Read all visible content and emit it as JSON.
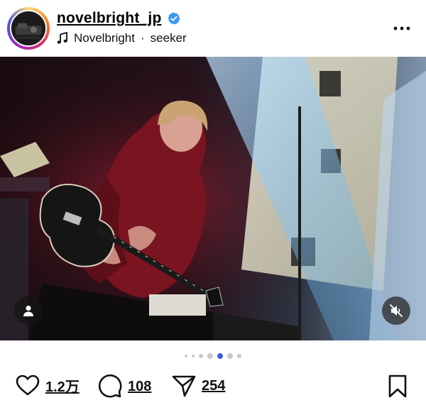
{
  "post": {
    "username": "novelbright_jp",
    "verified": true,
    "music": {
      "artist": "Novelbright",
      "separator": "·",
      "track": "seeker"
    }
  },
  "media": {
    "type": "photo",
    "carousel_count": 7,
    "carousel_active_index": 4
  },
  "actions": {
    "likes": "1.2万",
    "comments": "108",
    "shares": "254"
  },
  "colors": {
    "verified_badge": "#3897f0",
    "active_dot": "#3b5bdb",
    "inactive_dot": "#c8c8c8"
  },
  "icons": [
    "more-icon",
    "music-note-icon",
    "verified-badge-icon",
    "user-tag-icon",
    "muted-speaker-icon",
    "heart-icon",
    "comment-icon",
    "share-icon",
    "bookmark-icon"
  ]
}
